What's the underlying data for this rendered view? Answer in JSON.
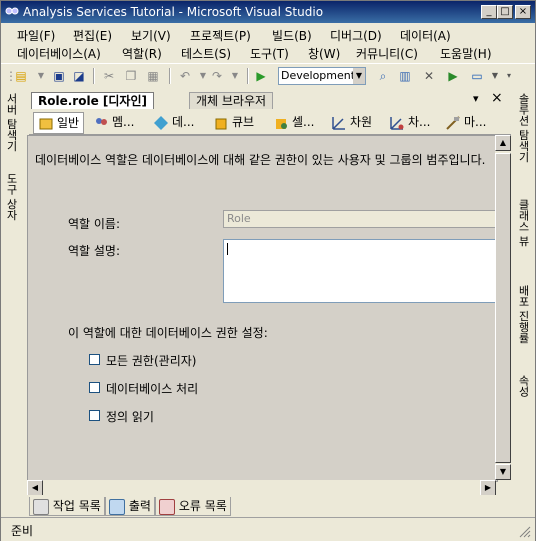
{
  "window": {
    "title": "Analysis Services Tutorial - Microsoft Visual Studio",
    "minimize_glyph": "_",
    "maximize_glyph": "□",
    "close_glyph": "×"
  },
  "menu": [
    "파일(F)",
    "편집(E)",
    "보기(V)",
    "프로젝트(P)",
    "빌드(B)",
    "디버그(D)",
    "데이터(A)",
    "데이터베이스(A)",
    "역할(R)",
    "테스트(S)",
    "도구(T)",
    "창(W)",
    "커뮤니티(C)",
    "도움말(H)"
  ],
  "toolbar": {
    "configuration": "Development"
  },
  "left_sidebar": [
    "서버 탐색기",
    "도구 상자"
  ],
  "right_sidebar": [
    "솔루션 탐색기",
    "클래스 뷰",
    "배포 진행률",
    "속성"
  ],
  "document_tabs": {
    "active": "Role.role [디자인]",
    "other": "개체 브라우저",
    "pin_glyph": "▾",
    "close_glyph": "×"
  },
  "designer_tabs": [
    "일반",
    "멤...",
    "데...",
    "큐브",
    "셀...",
    "차원",
    "차...",
    "마..."
  ],
  "general": {
    "description": "데이터베이스 역할은 데이터베이스에 대해 같은 권한이 있는 사용자 및 그룹의 범주입니다.",
    "role_name_label": "역할 이름:",
    "role_name_value": "Role",
    "role_desc_label": "역할 설명:",
    "permissions_heading": "이 역할에 대한 데이터베이스 권한 설정:",
    "checkboxes": [
      {
        "label": "모든 권한(관리자)",
        "checked": false
      },
      {
        "label": "데이터베이스 처리",
        "checked": false
      },
      {
        "label": "정의 읽기",
        "checked": false
      }
    ]
  },
  "bottom_tabs": [
    "작업 목록",
    "출력",
    "오류 목록"
  ],
  "status": "준비",
  "colors": {
    "title_bar": "#0a246a",
    "chrome": "#ece9d8",
    "pane": "#d4d0c8"
  }
}
